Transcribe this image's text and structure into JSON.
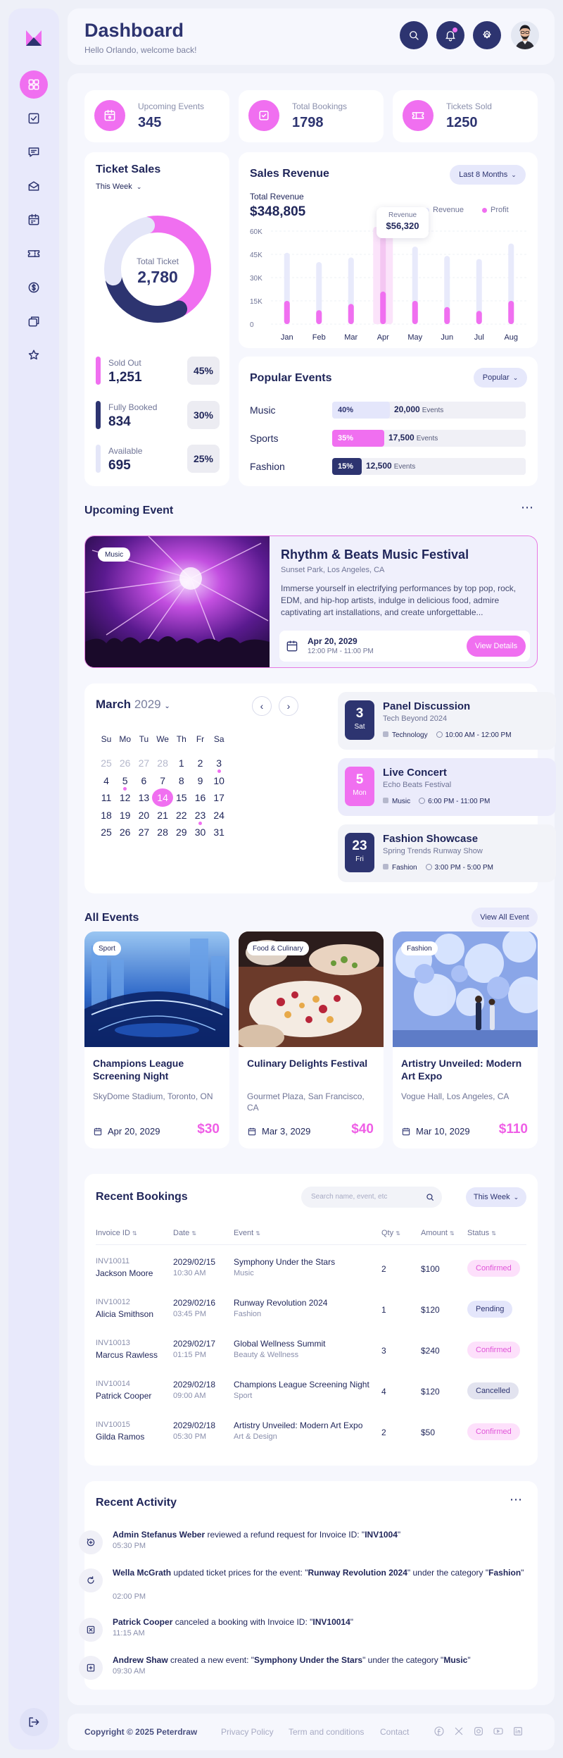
{
  "header": {
    "title": "Dashboard",
    "subtitle": "Hello Orlando, welcome back!"
  },
  "sidebar": {
    "items": [
      "dashboard-icon",
      "checkbox-icon",
      "message-icon",
      "inbox-icon",
      "calendar-icon",
      "ticket-icon",
      "dollar-icon",
      "cards-icon",
      "star-icon"
    ],
    "logout": "logout-icon"
  },
  "stats": [
    {
      "label": "Upcoming Events",
      "value": "345"
    },
    {
      "label": "Total Bookings",
      "value": "1798"
    },
    {
      "label": "Tickets Sold",
      "value": "1250"
    }
  ],
  "ticket_sales": {
    "title": "Ticket Sales",
    "filter": "This Week",
    "center_label": "Total Ticket",
    "center_value": "2,780",
    "legend": [
      {
        "label": "Sold Out",
        "value": "1,251",
        "pct": "45%",
        "color": "#f06ff0",
        "share": 0.45
      },
      {
        "label": "Fully Booked",
        "value": "834",
        "pct": "30%",
        "color": "#2d3470",
        "share": 0.3
      },
      {
        "label": "Available",
        "value": "695",
        "pct": "25%",
        "color": "#e4e6f8",
        "share": 0.25
      }
    ]
  },
  "sales_revenue": {
    "title": "Sales Revenue",
    "filter": "Last 8 Months",
    "total_label": "Total Revenue",
    "total_value": "$348,805",
    "legend_revenue": "Revenue",
    "legend_profit": "Profit",
    "tooltip_label": "Revenue",
    "tooltip_value": "$56,320"
  },
  "chart_data": {
    "type": "bar",
    "categories": [
      "Jan",
      "Feb",
      "Mar",
      "Apr",
      "May",
      "Jun",
      "Jul",
      "Aug"
    ],
    "series": [
      {
        "name": "Revenue",
        "values": [
          46000,
          40000,
          43000,
          56320,
          50000,
          44000,
          42000,
          52000
        ],
        "color": "#e8eafb"
      },
      {
        "name": "Profit",
        "values": [
          15000,
          9000,
          13000,
          21000,
          15000,
          11000,
          8500,
          15000
        ],
        "color": "#f06ff0"
      }
    ],
    "ylim": [
      0,
      60000
    ],
    "yticks": [
      "0",
      "15K",
      "30K",
      "45K",
      "60K"
    ],
    "highlight": "Apr"
  },
  "popular_events": {
    "title": "Popular Events",
    "filter": "Popular",
    "unit": "Events",
    "rows": [
      {
        "name": "Music",
        "pct": "40%",
        "share": 0.4,
        "count": "20,000",
        "fill": "#e4e6fb",
        "text": "#2d3470"
      },
      {
        "name": "Sports",
        "pct": "35%",
        "share": 0.35,
        "count": "17,500",
        "fill": "#f06ff0",
        "text": "#ffffff"
      },
      {
        "name": "Fashion",
        "pct": "15%",
        "share": 0.15,
        "count": "12,500",
        "fill": "#2d3470",
        "text": "#ffffff"
      }
    ]
  },
  "upcoming": {
    "title": "Upcoming Event",
    "tag": "Music",
    "event_title": "Rhythm & Beats Music Festival",
    "location": "Sunset Park, Los Angeles, CA",
    "description": "Immerse yourself in electrifying performances by top pop, rock, EDM, and hip-hop artists, indulge in delicious food, admire captivating art installations, and create unforgettable...",
    "date": "Apr 20, 2029",
    "time": "12:00 PM - 11:00 PM",
    "cta": "View Details"
  },
  "calendar": {
    "month": "March",
    "year": "2029",
    "weekdays": [
      "Su",
      "Mo",
      "Tu",
      "We",
      "Th",
      "Fr",
      "Sa"
    ],
    "weeks": [
      [
        "25",
        "26",
        "27",
        "28",
        "1",
        "2",
        "3"
      ],
      [
        "4",
        "5",
        "6",
        "7",
        "8",
        "9",
        "10"
      ],
      [
        "11",
        "12",
        "13",
        "14",
        "15",
        "16",
        "17"
      ],
      [
        "18",
        "19",
        "20",
        "21",
        "22",
        "23",
        "24"
      ],
      [
        "25",
        "26",
        "27",
        "28",
        "29",
        "30",
        "31"
      ]
    ],
    "today": "14",
    "event_days": [
      "3",
      "5",
      "23"
    ]
  },
  "schedule": [
    {
      "day": "3",
      "weekday": "Sat",
      "title": "Panel Discussion",
      "subtitle": "Tech Beyond 2024",
      "category": "Technology",
      "time": "10:00 AM - 12:00 PM"
    },
    {
      "day": "5",
      "weekday": "Mon",
      "title": "Live Concert",
      "subtitle": "Echo Beats Festival",
      "category": "Music",
      "time": "6:00 PM - 11:00 PM"
    },
    {
      "day": "23",
      "weekday": "Fri",
      "title": "Fashion Showcase",
      "subtitle": "Spring Trends Runway Show",
      "category": "Fashion",
      "time": "3:00 PM - 5:00 PM"
    }
  ],
  "all_events": {
    "title": "All Events",
    "cta": "View All Event",
    "items": [
      {
        "tag": "Sport",
        "title": "Champions League Screening Night",
        "location": "SkyDome Stadium, Toronto, ON",
        "date": "Apr 20, 2029",
        "price": "$30"
      },
      {
        "tag": "Food & Culinary",
        "title": "Culinary Delights Festival",
        "location": "Gourmet Plaza, San Francisco, CA",
        "date": "Mar 3, 2029",
        "price": "$40"
      },
      {
        "tag": "Fashion",
        "title": "Artistry Unveiled: Modern Art Expo",
        "location": "Vogue Hall, Los Angeles, CA",
        "date": "Mar 10, 2029",
        "price": "$110"
      }
    ]
  },
  "bookings": {
    "title": "Recent Bookings",
    "search_placeholder": "Search name, event, etc",
    "filter": "This Week",
    "headers": [
      "Invoice ID",
      "Date",
      "Event",
      "Qty",
      "Amount",
      "Status"
    ],
    "rows": [
      {
        "id": "INV10011",
        "name": "Jackson Moore",
        "date": "2029/02/15",
        "time": "10:30 AM",
        "event": "Symphony Under the Stars",
        "category": "Music",
        "qty": "2",
        "amount": "$100",
        "status": "Confirmed"
      },
      {
        "id": "INV10012",
        "name": "Alicia Smithson",
        "date": "2029/02/16",
        "time": "03:45 PM",
        "event": "Runway Revolution 2024",
        "category": "Fashion",
        "qty": "1",
        "amount": "$120",
        "status": "Pending"
      },
      {
        "id": "INV10013",
        "name": "Marcus Rawless",
        "date": "2029/02/17",
        "time": "01:15 PM",
        "event": "Global Wellness Summit",
        "category": "Beauty & Wellness",
        "qty": "3",
        "amount": "$240",
        "status": "Confirmed"
      },
      {
        "id": "INV10014",
        "name": "Patrick Cooper",
        "date": "2029/02/18",
        "time": "09:00 AM",
        "event": "Champions League Screening Night",
        "category": "Sport",
        "qty": "4",
        "amount": "$120",
        "status": "Cancelled"
      },
      {
        "id": "INV10015",
        "name": "Gilda Ramos",
        "date": "2029/02/18",
        "time": "05:30 PM",
        "event": "Artistry Unveiled: Modern Art Expo",
        "category": "Art & Design",
        "qty": "2",
        "amount": "$50",
        "status": "Confirmed"
      }
    ]
  },
  "activity": {
    "title": "Recent Activity",
    "items": [
      {
        "icon": "refund-icon",
        "user": "Admin Stefanus Weber",
        "pre": " reviewed a refund request for Invoice ID: \"",
        "strong": "INV1004",
        "post": "\"",
        "time": "05:30 PM"
      },
      {
        "icon": "refresh-icon",
        "user": "Wella McGrath",
        "pre": " updated ticket prices for the event: \"",
        "strong": "Runway Revolution 2024",
        "mid": "\" under the category \"",
        "strong2": "Fashion",
        "post": "\"",
        "time": "02:00 PM"
      },
      {
        "icon": "cancel-icon",
        "user": "Patrick Cooper",
        "pre": " canceled a booking with Invoice ID: \"",
        "strong": "INV10014",
        "post": "\"",
        "time": "11:15 AM"
      },
      {
        "icon": "add-icon",
        "user": "Andrew Shaw",
        "pre": " created a new event: \"",
        "strong": "Symphony Under the Stars",
        "mid": "\" under the category \"",
        "strong2": "Music",
        "post": "\"",
        "time": "09:30 AM"
      }
    ]
  },
  "footer": {
    "copyright": "Copyright © 2025 Peterdraw",
    "links": [
      "Privacy Policy",
      "Term and conditions",
      "Contact"
    ],
    "social": [
      "facebook-icon",
      "x-icon",
      "instagram-icon",
      "youtube-icon",
      "linkedin-icon"
    ]
  }
}
